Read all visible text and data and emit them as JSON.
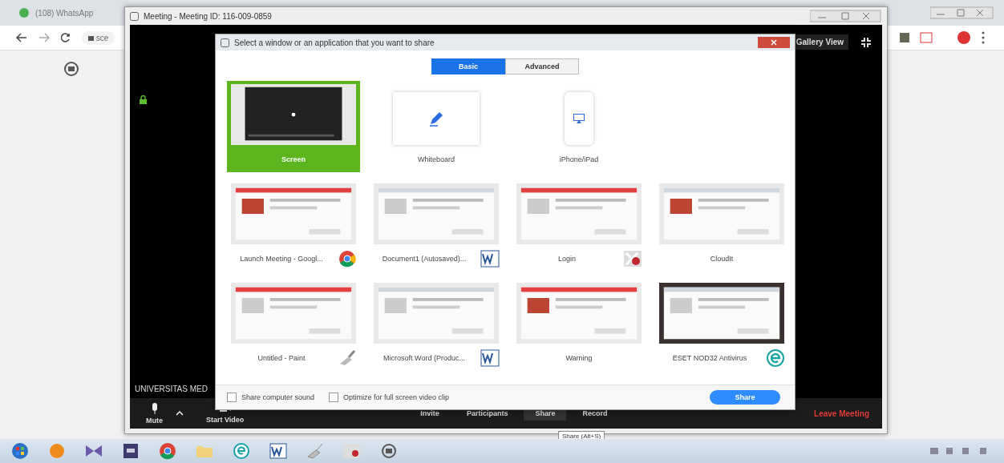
{
  "browser": {
    "tab_title": "(108) WhatsApp",
    "address": "sce"
  },
  "meeting_window": {
    "title": "Meeting - Meeting ID: 116-009-0859",
    "view_button": "Gallery View",
    "participant_name": "UNIVERSITAS MED",
    "toolbar": [
      {
        "label": "Mute",
        "kind": "mic",
        "selected": false
      },
      {
        "label": "Start Video",
        "kind": "video",
        "selected": false
      },
      {
        "label": "Invite",
        "kind": "plain",
        "selected": false
      },
      {
        "label": "Participants",
        "kind": "plain",
        "selected": false
      },
      {
        "label": "Share",
        "kind": "plain",
        "selected": true
      },
      {
        "label": "Record",
        "kind": "plain",
        "selected": false
      }
    ],
    "leave_button": "Leave Meeting",
    "tooltip": "Share (Alt+S)"
  },
  "share_dialog": {
    "title": "Select a window or an application that you want to share",
    "tabs": [
      {
        "label": "Basic",
        "selected": true
      },
      {
        "label": "Advanced",
        "selected": false
      }
    ],
    "items": [
      {
        "label": "Screen",
        "kind": "screen",
        "selected": true
      },
      {
        "label": "Whiteboard",
        "kind": "whiteboard",
        "selected": false
      },
      {
        "label": "iPhone/iPad",
        "kind": "device",
        "selected": false
      },
      {
        "label": "Launch Meeting - Googl...",
        "kind": "chrome",
        "selected": false
      },
      {
        "label": "Document1 (Autosaved)...",
        "kind": "word",
        "selected": false
      },
      {
        "label": "Login",
        "kind": "cloudit",
        "selected": false
      },
      {
        "label": "CloudIt",
        "kind": "window",
        "selected": false
      },
      {
        "label": "Untitled - Paint",
        "kind": "paint",
        "selected": false
      },
      {
        "label": "Microsoft Word (Produc...",
        "kind": "word",
        "selected": false
      },
      {
        "label": "Warning",
        "kind": "window",
        "selected": false
      },
      {
        "label": "ESET NOD32 Antivirus",
        "kind": "eset",
        "selected": false
      }
    ],
    "options": [
      {
        "label": "Share computer sound",
        "checked": false
      },
      {
        "label": "Optimize for full screen video clip",
        "checked": false
      }
    ],
    "share_button": "Share"
  },
  "taskbar": [
    {
      "kind": "start"
    },
    {
      "kind": "orange"
    },
    {
      "kind": "bow"
    },
    {
      "kind": "ae"
    },
    {
      "kind": "chrome"
    },
    {
      "kind": "folder"
    },
    {
      "kind": "eset"
    },
    {
      "kind": "word"
    },
    {
      "kind": "paint"
    },
    {
      "kind": "cloudit"
    },
    {
      "kind": "zoom"
    }
  ]
}
